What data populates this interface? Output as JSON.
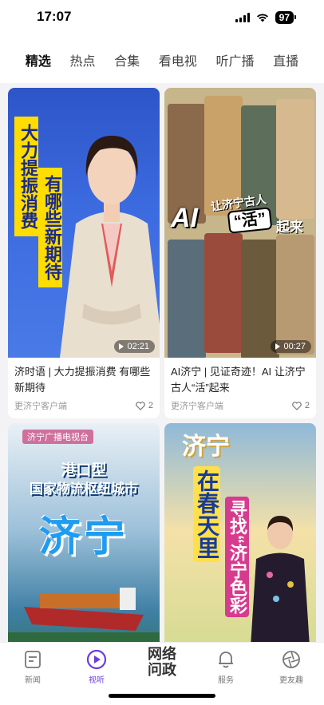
{
  "status_bar": {
    "time": "17:07",
    "battery": "97"
  },
  "tabs": [
    {
      "label": "精选",
      "active": true
    },
    {
      "label": "热点",
      "active": false
    },
    {
      "label": "合集",
      "active": false
    },
    {
      "label": "看电视",
      "active": false
    },
    {
      "label": "听广播",
      "active": false
    },
    {
      "label": "直播",
      "active": false
    }
  ],
  "cards": [
    {
      "thumb_text_1": "大力提振消费",
      "thumb_text_2": "有哪些新期待",
      "duration": "02:21",
      "title": "济时语 | 大力提振消费 有哪些新期待",
      "source": "更济宁客户端",
      "likes": "2"
    },
    {
      "thumb_big": "AI",
      "thumb_sub": "让济宁古人",
      "thumb_live": "“活”",
      "thumb_end": "起来",
      "duration": "00:27",
      "title": "AI济宁 | 见证奇迹！AI 让济宁古人“活”起来",
      "source": "更济宁客户端",
      "likes": "2"
    },
    {
      "thumb_brand": "济宁广播电视台",
      "thumb_sub1": "港口型",
      "thumb_sub2": "国家物流枢纽城市",
      "thumb_big": "济宁"
    },
    {
      "thumb_city": "济宁",
      "thumb_v1": "在春天里",
      "thumb_v2": "寻找“济宁色彩"
    }
  ],
  "bottom_nav": {
    "news": "新闻",
    "video": "视听",
    "center_line1": "网络",
    "center_line2": "问政",
    "service": "服务",
    "fun": "更友趣"
  },
  "colors": {
    "accent": "#6a3de0",
    "thumb1_bg": "#3c6be0",
    "yellow": "#ffdd00"
  }
}
